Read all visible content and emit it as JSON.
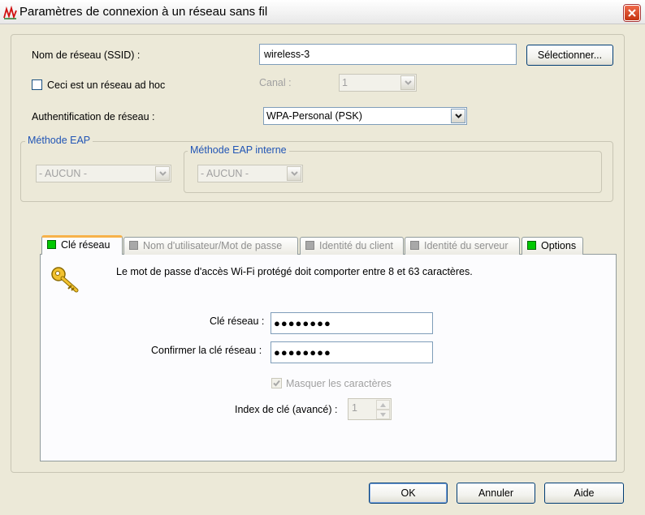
{
  "window": {
    "title": "Paramètres de connexion à un réseau sans fil",
    "app_icon": "wireless-signal-icon",
    "close_icon": "close-icon"
  },
  "ssid": {
    "label": "Nom de réseau (SSID) :",
    "value": "wireless-3",
    "select_button": "Sélectionner..."
  },
  "adhoc": {
    "label": "Ceci est un réseau ad hoc",
    "checked": false
  },
  "channel": {
    "label": "Canal :",
    "value": "1"
  },
  "auth": {
    "label": "Authentification de réseau :",
    "value": "WPA-Personal (PSK)"
  },
  "eap": {
    "group_label": "Méthode EAP",
    "value": "- AUCUN -",
    "inner_group_label": "Méthode EAP interne",
    "inner_value": "- AUCUN -"
  },
  "tabs": [
    {
      "label": "Clé réseau",
      "indicator": "green",
      "active": true
    },
    {
      "label": "Nom d'utilisateur/Mot de passe",
      "indicator": "gray",
      "active": false
    },
    {
      "label": "Identité du client",
      "indicator": "gray",
      "active": false
    },
    {
      "label": "Identité du serveur",
      "indicator": "gray",
      "active": false
    },
    {
      "label": "Options",
      "indicator": "green",
      "active": false
    }
  ],
  "network_key": {
    "icon": "key-icon",
    "description": "Le mot de passe d'accès Wi-Fi protégé doit comporter entre 8 et 63 caractères.",
    "key_label": "Clé réseau :",
    "key_value": "●●●●●●●●",
    "confirm_label": "Confirmer la clé réseau :",
    "confirm_value": "●●●●●●●●",
    "mask_label": "Masquer les caractères",
    "mask_checked": true,
    "index_label": "Index de clé (avancé) :",
    "index_value": "1"
  },
  "footer": {
    "ok": "OK",
    "cancel": "Annuler",
    "help": "Aide"
  },
  "colors": {
    "window_bg": "#ece9d8",
    "group_label": "#2155b5",
    "indicator_green": "#00c800",
    "indicator_gray": "#a8a8a8",
    "active_tab_accent": "#f7b24a"
  }
}
